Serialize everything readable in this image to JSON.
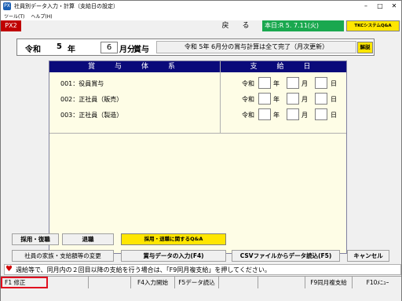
{
  "window": {
    "title": "社員別データ入力・計算（支給日の設定）",
    "icon_label": "PX"
  },
  "menu": [
    "ツール(T)",
    "ヘルプ(H)"
  ],
  "header": {
    "system_code": "PX2",
    "back_label": "戻　る",
    "today_label": "本日:R 5. 7.11(火)",
    "qa_label": "TKCシステムQ&A"
  },
  "period": {
    "era": "令和",
    "year": "5",
    "year_unit": "年",
    "month": "6",
    "month_unit": "月分",
    "kind": "賞与",
    "status": "令和 5年 6月分の賞与計算は全て完了（月次更新）",
    "help_label": "解説"
  },
  "table": {
    "col_system": "賞　与　体　系",
    "col_date": "支　給　日",
    "rows": [
      {
        "label": "001：役員賞与",
        "era": "令和",
        "year": "",
        "month": "",
        "day": ""
      },
      {
        "label": "002：正社員（販売）",
        "era": "令和",
        "year": "",
        "month": "",
        "day": ""
      },
      {
        "label": "003：正社員（製造）",
        "era": "令和",
        "year": "",
        "month": "",
        "day": ""
      }
    ],
    "unit_year": "年",
    "unit_month": "月",
    "unit_day": "日"
  },
  "buttons": {
    "hire": "採用・復職",
    "retire": "退職",
    "hire_qa": "採用・退職に関するQ&A",
    "family": "社員の家族・支給額等の変更",
    "bonus_input": "賞与データの入力(F4)",
    "csv": "CSVファイルからデータ読込(F5)",
    "cancel": "キャンセル"
  },
  "notice": "週給等で、同月内の２回目以降の支給を行う場合は、「F9同月複支給」を押してください。",
  "fkeys": {
    "f1": "F1 修正",
    "f4": "F4入力開始",
    "f5": "F5データ読込",
    "f9": "F9同月複支給",
    "f10": "F10ﾒﾆｭｰ"
  },
  "colors": {
    "system_code_bg": "#c00000",
    "today_bg": "#1aa84f",
    "qa_bg": "#ffe600",
    "table_header_bg": "#0a0a7a",
    "table_bg": "#fefde6",
    "f1_border": "#e01020",
    "notice_icon": "#d00000"
  },
  "icons": {
    "notice": "heart-icon",
    "close": "close-icon",
    "minimize": "minimize-icon",
    "maximize": "maximize-icon"
  }
}
